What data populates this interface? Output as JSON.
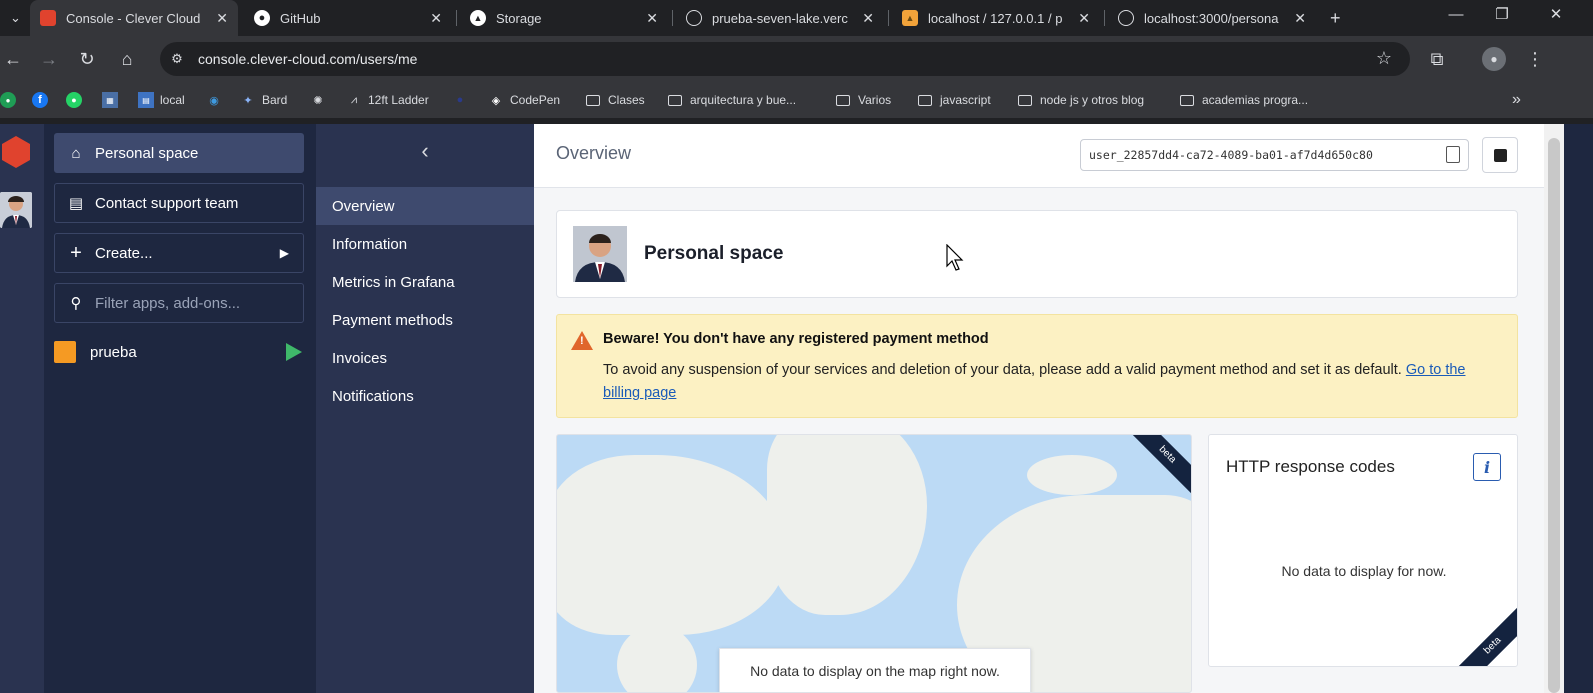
{
  "browser": {
    "tabs": [
      {
        "title": "Console - Clever Cloud",
        "active": true,
        "favicon": "clever-cloud-icon"
      },
      {
        "title": "GitHub",
        "favicon": "github-icon"
      },
      {
        "title": "Storage",
        "favicon": "vercel-icon"
      },
      {
        "title": "prueba-seven-lake.verc",
        "favicon": "globe-icon"
      },
      {
        "title": "localhost / 127.0.0.1 / p",
        "favicon": "phpmyadmin-icon"
      },
      {
        "title": "localhost:3000/persona",
        "favicon": "globe-icon"
      }
    ],
    "new_tab": "+",
    "url": "console.clever-cloud.com/users/me",
    "bookmarks": [
      {
        "label": "local"
      },
      {
        "label": "Bard"
      },
      {
        "label": "12ft Ladder"
      },
      {
        "label": "CodePen"
      },
      {
        "label": "Clases"
      },
      {
        "label": "arquitectura y bue..."
      },
      {
        "label": "Varios"
      },
      {
        "label": "javascript"
      },
      {
        "label": "node js y otros blog"
      },
      {
        "label": "academias progra..."
      }
    ],
    "more_bookmarks": "»"
  },
  "sidebar": {
    "personal_space": "Personal space",
    "contact_support": "Contact support team",
    "create": "Create...",
    "filter_placeholder": "Filter apps, add-ons...",
    "apps": [
      {
        "name": "prueba"
      }
    ]
  },
  "subnav": {
    "items": [
      "Overview",
      "Information",
      "Metrics in Grafana",
      "Payment methods",
      "Invoices",
      "Notifications"
    ]
  },
  "main": {
    "title": "Overview",
    "user_id": "user_22857dd4-ca72-4089-ba01-af7d4d650c80",
    "card_title": "Personal space",
    "warning": {
      "title": "Beware! You don't have any registered payment method",
      "text": "To avoid any suspension of your services and deletion of your data, please add a valid payment method and set it as default.",
      "link": "Go to the billing page"
    },
    "map": {
      "badge": "beta",
      "empty_message": "No data to display on the map right now."
    },
    "http": {
      "title": "HTTP response codes",
      "empty_message": "No data to display for now.",
      "badge": "beta"
    }
  }
}
